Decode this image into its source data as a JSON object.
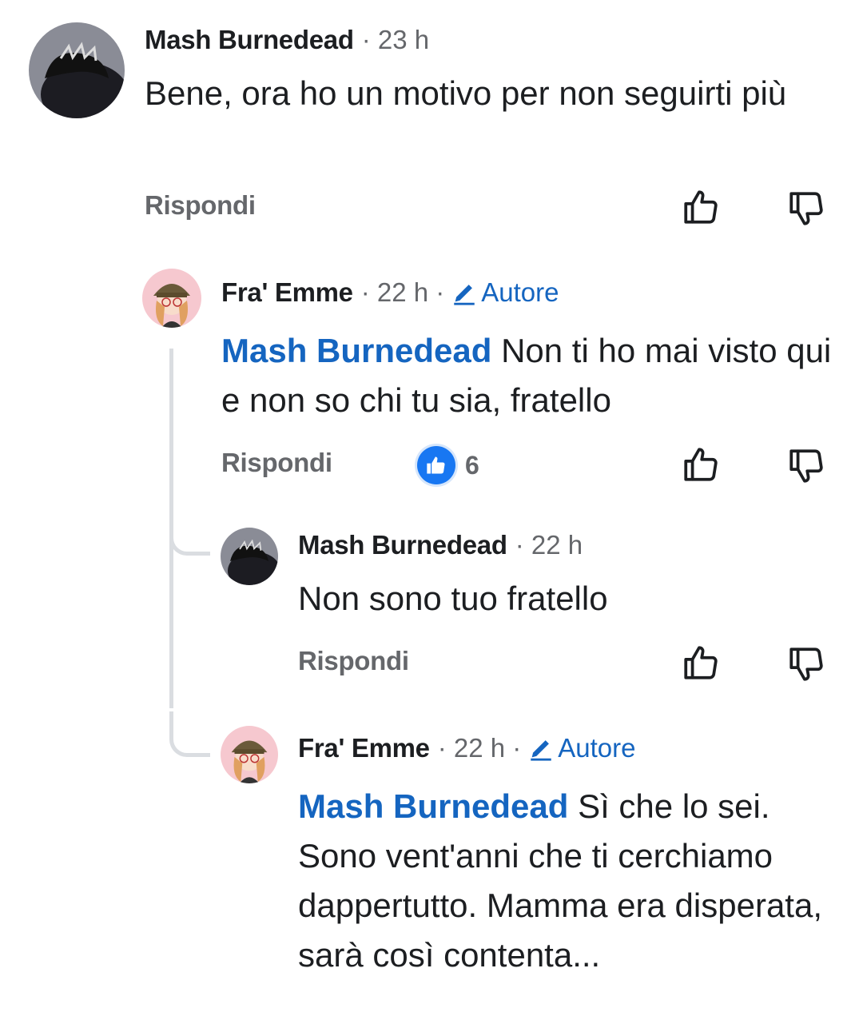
{
  "comments": [
    {
      "author": "Mash Burnedead",
      "time": "· 23 h",
      "text": "Bene, ora ho un motivo per non seguirti più",
      "reply_label": "Rispondi"
    },
    {
      "author": "Fra' Emme",
      "time": "· 22 h ·",
      "badge": "Autore",
      "mention": "Mash Burnedead",
      "text": " Non ti ho mai visto qui e non so chi tu sia, fratello",
      "reply_label": "Rispondi",
      "likes": "6"
    },
    {
      "author": "Mash Burnedead",
      "time": "· 22 h",
      "text": "Non sono tuo fratello",
      "reply_label": "Rispondi"
    },
    {
      "author": "Fra' Emme",
      "time": "· 22 h ·",
      "badge": "Autore",
      "mention": "Mash Burnedead",
      "text": " Sì che lo sei. Sono vent'anni che ti cerchiamo dappertutto. Mamma era disperata, sarà così contenta..."
    }
  ],
  "icons": {
    "like": "thumb-up-outline-icon",
    "dislike": "thumb-down-outline-icon",
    "reaction": "like-reaction-icon",
    "badge": "pencil-icon"
  },
  "colors": {
    "accent": "#1565c0",
    "reaction": "#1877f2",
    "muted": "#65676b",
    "thread": "#dadde1"
  }
}
